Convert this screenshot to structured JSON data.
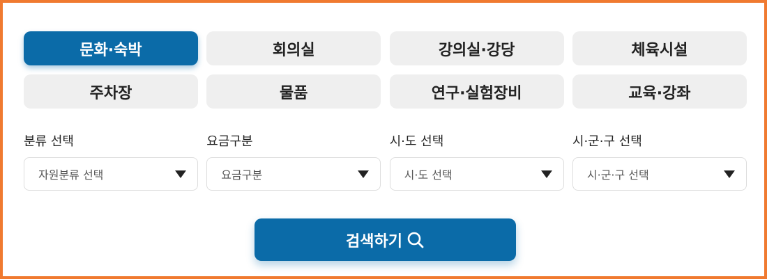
{
  "categories": [
    {
      "label": "문화·숙박",
      "active": true
    },
    {
      "label": "회의실",
      "active": false
    },
    {
      "label": "강의실·강당",
      "active": false
    },
    {
      "label": "체육시설",
      "active": false
    },
    {
      "label": "주차장",
      "active": false
    },
    {
      "label": "물품",
      "active": false
    },
    {
      "label": "연구·실험장비",
      "active": false
    },
    {
      "label": "교육·강좌",
      "active": false
    }
  ],
  "filters": [
    {
      "label": "분류 선택",
      "value": "자원분류 선택"
    },
    {
      "label": "요금구분",
      "value": "요금구분"
    },
    {
      "label": "시·도 선택",
      "value": "시·도 선택"
    },
    {
      "label": "시·군·구 선택",
      "value": "시·군·구 선택"
    }
  ],
  "search": {
    "label": "검색하기",
    "icon": "search-icon"
  },
  "colors": {
    "primary": "#0b6ba8",
    "border": "#f07a30",
    "inactive_bg": "#efefef"
  }
}
